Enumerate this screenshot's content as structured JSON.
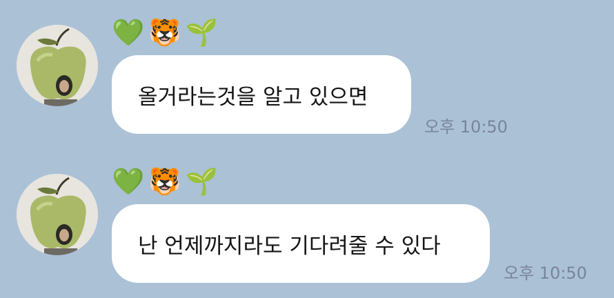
{
  "messages": [
    {
      "profile_badges": [
        "💚",
        "🐯",
        "🌱"
      ],
      "text": "올거라는것을 알고 있으면",
      "time": "오후 10:50"
    },
    {
      "profile_badges": [
        "💚",
        "🐯",
        "🌱"
      ],
      "text": "난 언제까지라도 기다려줄 수 있다",
      "time": "오후 10:50"
    }
  ],
  "colors": {
    "background": "#abc1d6",
    "bubble": "#ffffff",
    "time_text": "#78859a"
  },
  "icons": {
    "avatar": "green-apple-avatar-icon",
    "badges": [
      "green-heart-icon",
      "tiger-face-icon",
      "seedling-icon"
    ]
  }
}
